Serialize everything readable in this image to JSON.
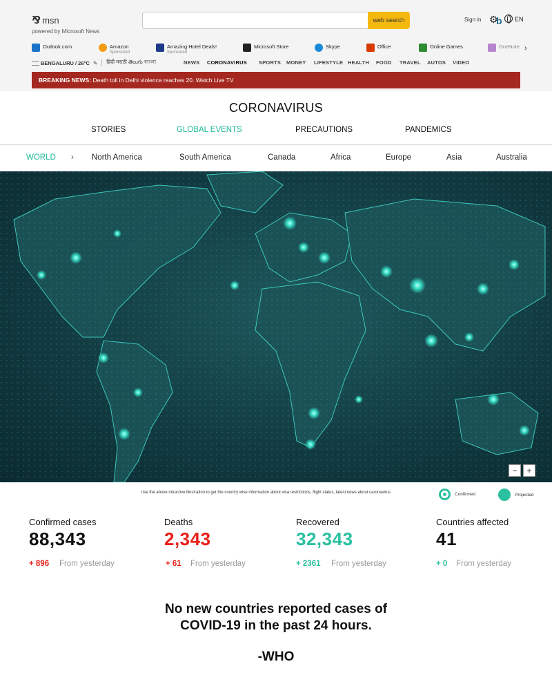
{
  "header": {
    "logo_text": "msn",
    "logo_sub": "powered by Microsoft News",
    "search_placeholder": "",
    "search_button": "web search",
    "sign_in": "Sign in",
    "language": "EN"
  },
  "shortcuts": [
    {
      "label": "Outlook.com",
      "sub": "",
      "color": "#1a73c8",
      "icon": "outlook-icon"
    },
    {
      "label": "Amazon",
      "sub": "Sponsored",
      "color": "#f39c12",
      "icon": "amazon-icon"
    },
    {
      "label": "Amazing Hotel Deals!",
      "sub": "Sponsored",
      "color": "#1b3a8a",
      "icon": "booking-icon"
    },
    {
      "label": "Microsoft Store",
      "sub": "",
      "color": "#222222",
      "icon": "store-icon"
    },
    {
      "label": "Skype",
      "sub": "",
      "color": "#1a8ad8",
      "icon": "skype-icon"
    },
    {
      "label": "Office",
      "sub": "",
      "color": "#d83b01",
      "icon": "office-icon"
    },
    {
      "label": "Online Games",
      "sub": "",
      "color": "#2e8b2e",
      "icon": "games-icon"
    },
    {
      "label": "OneNote",
      "sub": "",
      "color": "#7719aa",
      "icon": "onenote-icon"
    }
  ],
  "nav": {
    "location": "BENGALURU / 26°C",
    "languages": "हिंदी मराठी తెలుగు বাংলা",
    "items": [
      "NEWS",
      "CORONAVIRUS",
      "SPORTS",
      "MONEY",
      "LIFESTYLE",
      "HEALTH",
      "FOOD",
      "TRAVEL",
      "AUTOS",
      "VIDEO"
    ],
    "active": "CORONAVIRUS"
  },
  "breaking": {
    "label": "BREAKING NEWS:",
    "text": "Death toll in Delhi violence reaches 20. Watch Live TV"
  },
  "page_title": "CORONAVIRUS",
  "tabs": [
    {
      "label": "STORIES",
      "active": false
    },
    {
      "label": "GLOBAL EVENTS",
      "active": true
    },
    {
      "label": "PRECAUTIONS",
      "active": false
    },
    {
      "label": "PANDEMICS",
      "active": false
    }
  ],
  "regions": [
    "WORLD",
    "North America",
    "South America",
    "Canada",
    "Africa",
    "Europe",
    "Asia",
    "Australia"
  ],
  "map": {
    "zoom_out": "−",
    "zoom_in": "+",
    "caption": "Use the above intractive illustration to get the country wise information about visa restrictions, flight status, latest news about caronavirus",
    "legend_confirmed": "Confirmed",
    "legend_projected": "Projected"
  },
  "stats": [
    {
      "label": "Confirmed cases",
      "value": "88,343",
      "change": "+ 896",
      "from": "From yesterday",
      "value_color": "#111111",
      "change_color": "#e8201a"
    },
    {
      "label": "Deaths",
      "value": "2,343",
      "change": "+ 61",
      "from": "From yesterday",
      "value_color": "#e8201a",
      "change_color": "#e8201a"
    },
    {
      "label": "Recovered",
      "value": "32,343",
      "change": "+ 2361",
      "from": "From yesterday",
      "value_color": "#2bc0a0",
      "change_color": "#2bc0a0"
    },
    {
      "label": "Countries affected",
      "value": "41",
      "change": "+ 0",
      "from": "From yesterday",
      "value_color": "#111111",
      "change_color": "#2bc0a0"
    }
  ],
  "quote": {
    "line1": "No new countries reported cases of",
    "line2": "COVID-19 in the past 24 hours.",
    "attribution": "-WHO"
  },
  "colors": {
    "accent": "#2bc0a0",
    "breaking_bg": "#a52820",
    "search_button": "#f5b80f"
  }
}
